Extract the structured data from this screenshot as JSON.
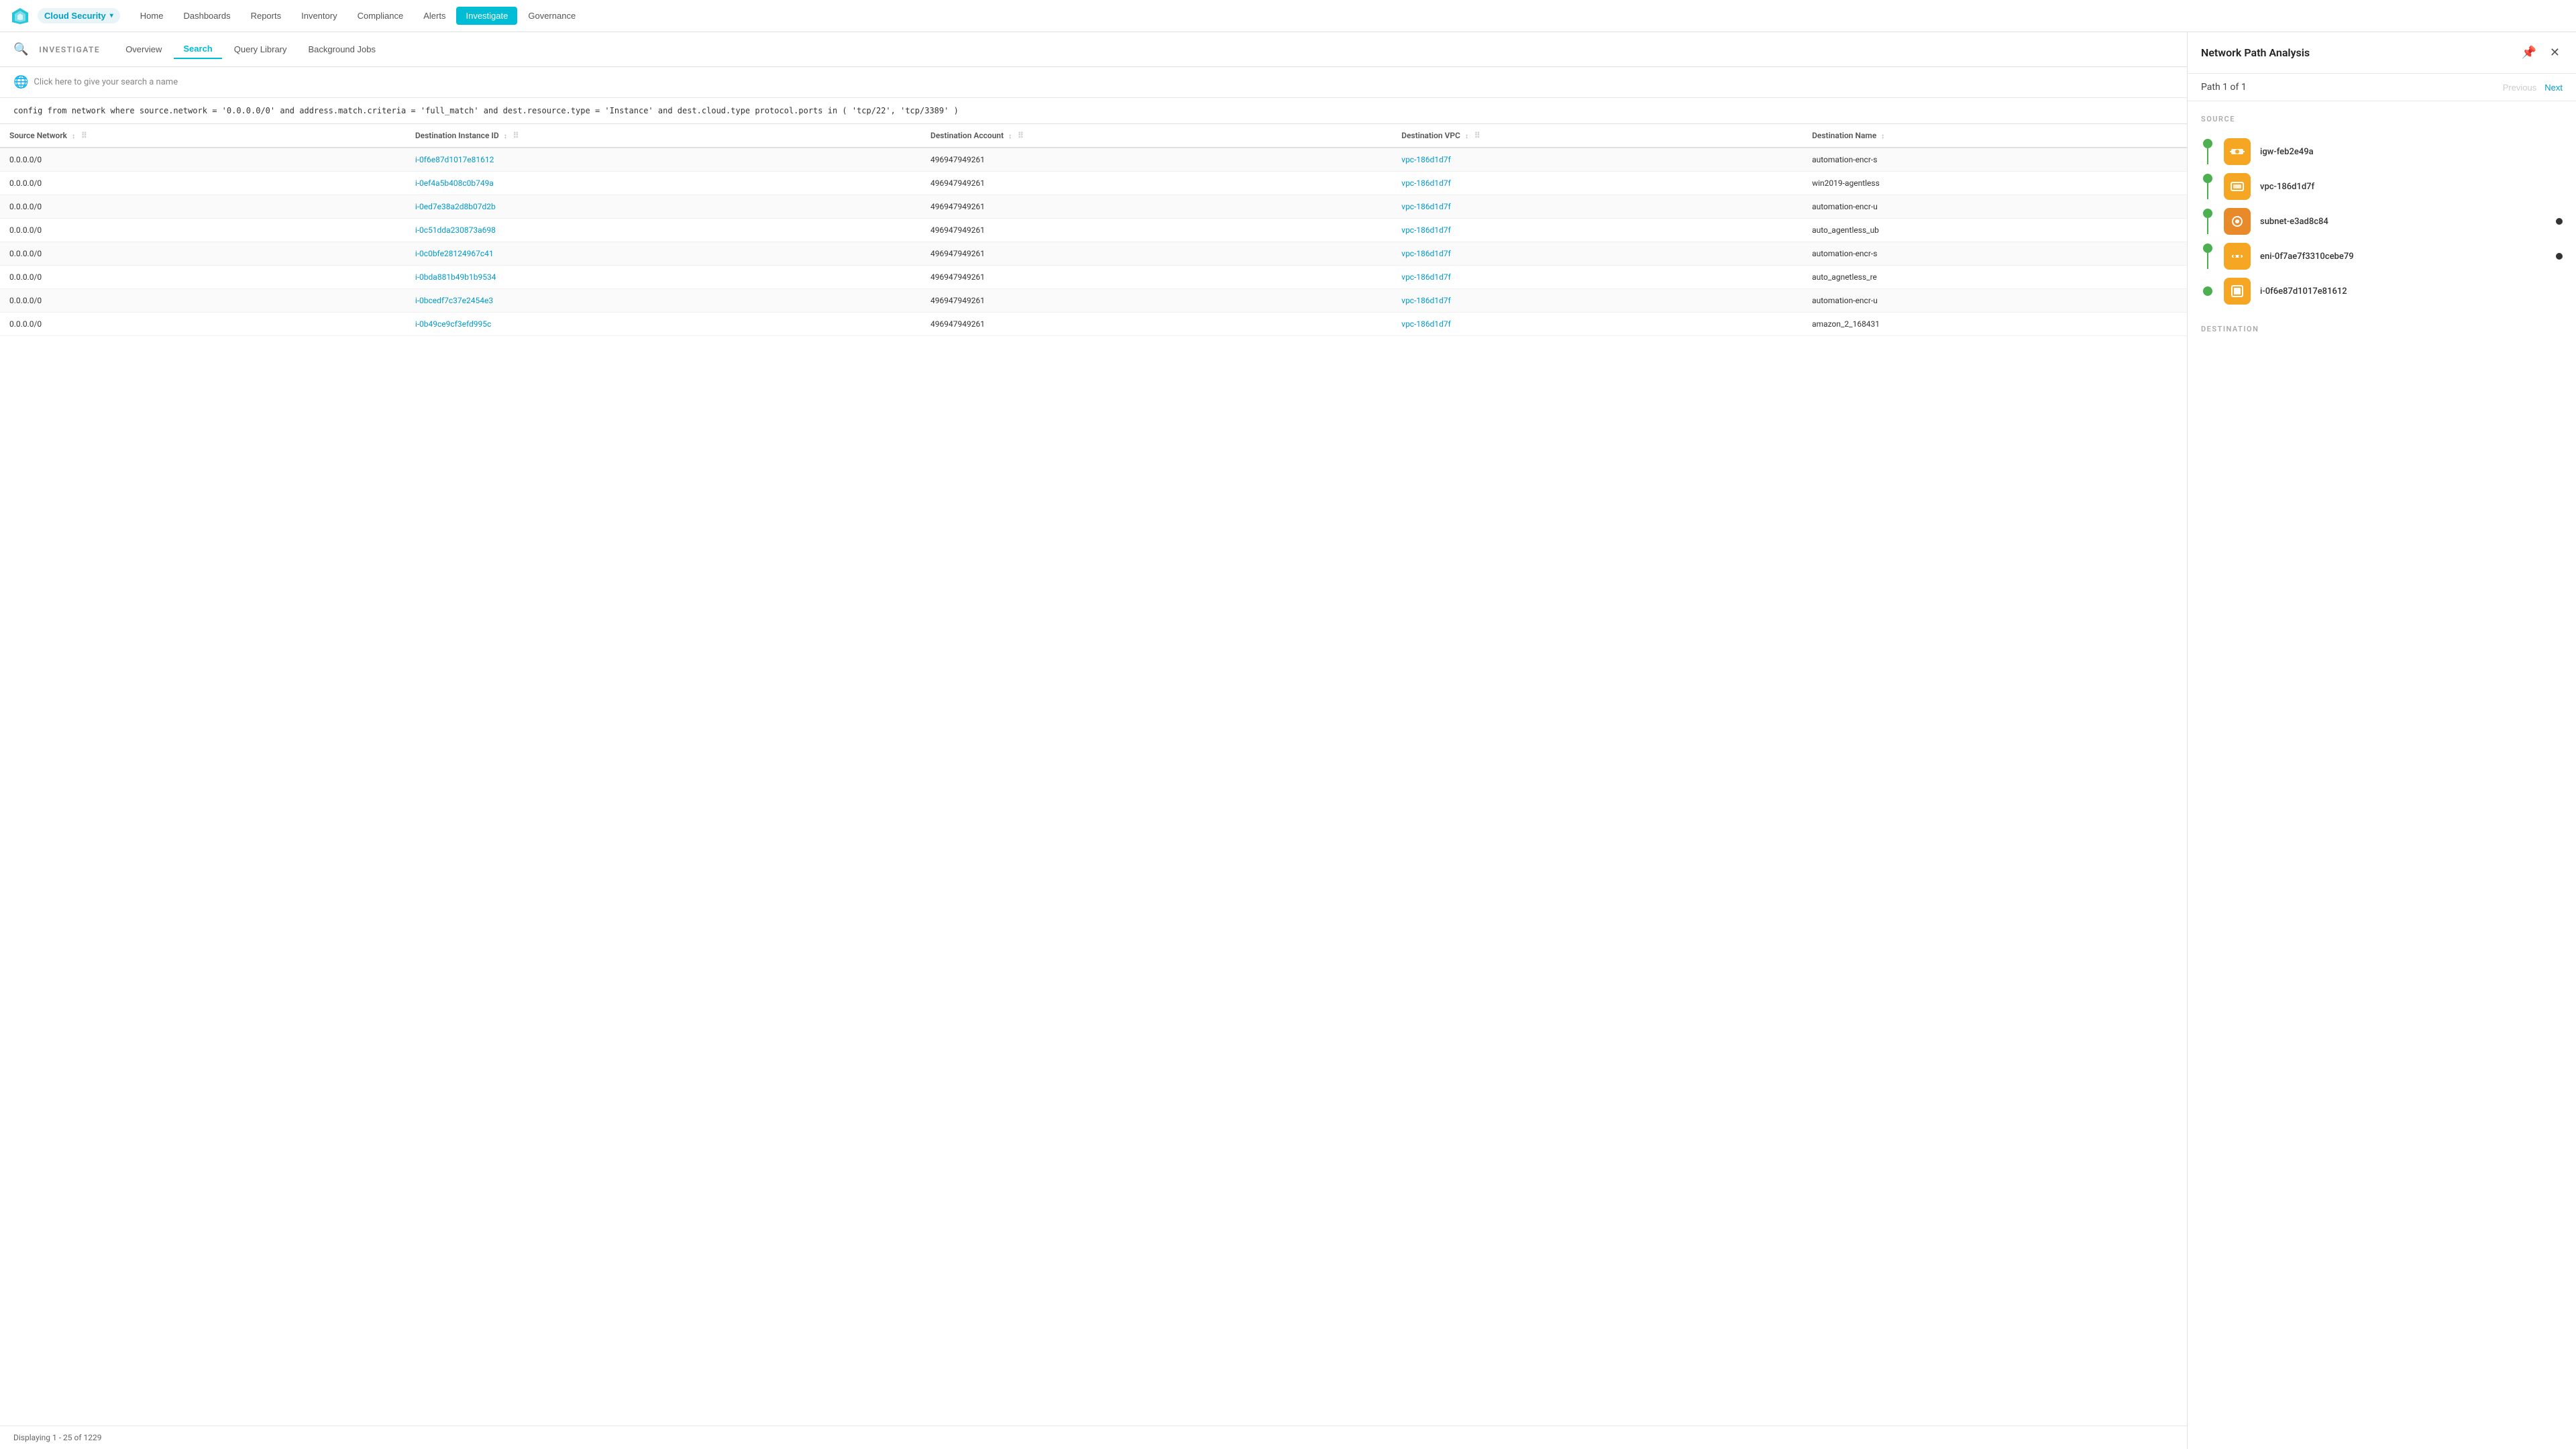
{
  "topNav": {
    "brand": "Cloud Security",
    "brandChevron": "▾",
    "links": [
      "Home",
      "Dashboards",
      "Reports",
      "Inventory",
      "Compliance",
      "Alerts",
      "Investigate",
      "Governance"
    ],
    "activeLink": "Investigate"
  },
  "investigate": {
    "title": "INVESTIGATE",
    "tabs": [
      "Overview",
      "Search",
      "Query Library",
      "Background Jobs"
    ],
    "activeTab": "Search"
  },
  "searchName": {
    "placeholder": "Click here to give your search a name"
  },
  "query": "config from network where source.network = '0.0.0.0/0' and address.match.criteria = 'full_match' and dest.resource.type = 'Instance' and dest.cloud.type protocol.ports in ( 'tcp/22', 'tcp/3389' )",
  "table": {
    "columns": [
      {
        "label": "Source Network",
        "key": "sourceNetwork"
      },
      {
        "label": "Destination Instance ID",
        "key": "destInstanceId"
      },
      {
        "label": "Destination Account",
        "key": "destAccount"
      },
      {
        "label": "Destination VPC",
        "key": "destVpc"
      },
      {
        "label": "Destination Name",
        "key": "destName"
      }
    ],
    "rows": [
      {
        "sourceNetwork": "0.0.0.0/0",
        "destInstanceId": "i-0f6e87d1017e81612",
        "destAccount": "496947949261",
        "destVpc": "vpc-186d1d7f",
        "destName": "automation-encr-s"
      },
      {
        "sourceNetwork": "0.0.0.0/0",
        "destInstanceId": "i-0ef4a5b408c0b749a",
        "destAccount": "496947949261",
        "destVpc": "vpc-186d1d7f",
        "destName": "win2019-agentless"
      },
      {
        "sourceNetwork": "0.0.0.0/0",
        "destInstanceId": "i-0ed7e38a2d8b07d2b",
        "destAccount": "496947949261",
        "destVpc": "vpc-186d1d7f",
        "destName": "automation-encr-u"
      },
      {
        "sourceNetwork": "0.0.0.0/0",
        "destInstanceId": "i-0c51dda230873a698",
        "destAccount": "496947949261",
        "destVpc": "vpc-186d1d7f",
        "destName": "auto_agentless_ub"
      },
      {
        "sourceNetwork": "0.0.0.0/0",
        "destInstanceId": "i-0c0bfe28124967c41",
        "destAccount": "496947949261",
        "destVpc": "vpc-186d1d7f",
        "destName": "automation-encr-s"
      },
      {
        "sourceNetwork": "0.0.0.0/0",
        "destInstanceId": "i-0bda881b49b1b9534",
        "destAccount": "496947949261",
        "destVpc": "vpc-186d1d7f",
        "destName": "auto_agnetless_re"
      },
      {
        "sourceNetwork": "0.0.0.0/0",
        "destInstanceId": "i-0bcedf7c37e2454e3",
        "destAccount": "496947949261",
        "destVpc": "vpc-186d1d7f",
        "destName": "automation-encr-u"
      },
      {
        "sourceNetwork": "0.0.0.0/0",
        "destInstanceId": "i-0b49ce9cf3efd995c",
        "destAccount": "496947949261",
        "destVpc": "vpc-186d1d7f",
        "destName": "amazon_2_168431"
      }
    ],
    "footer": "Displaying 1 - 25 of 1229"
  },
  "rightPanel": {
    "title": "Network Path Analysis",
    "pathLabel": "Path",
    "pathCurrent": "1",
    "pathOf": "of",
    "pathTotal": "1",
    "prevBtn": "Previous",
    "nextBtn": "Next",
    "sourceLabel": "SOURCE",
    "destinationLabel": "DESTINATION",
    "nodes": [
      {
        "id": "igw-feb2e49a",
        "iconType": "gateway",
        "hasExtraDot": false,
        "hasLine": true
      },
      {
        "id": "vpc-186d1d7f",
        "iconType": "vpc",
        "hasExtraDot": false,
        "hasLine": true
      },
      {
        "id": "subnet-e3ad8c84",
        "iconType": "subnet",
        "hasExtraDot": true,
        "hasLine": true
      },
      {
        "id": "eni-0f7ae7f3310cebe79",
        "iconType": "eni",
        "hasExtraDot": true,
        "hasLine": true
      },
      {
        "id": "i-0f6e87d1017e81612",
        "iconType": "instance",
        "hasExtraDot": false,
        "hasLine": false
      }
    ]
  },
  "icons": {
    "pinIcon": "📌",
    "closeIcon": "✕",
    "searchIcon": "🔍",
    "globeIcon": "🌐",
    "sortIcon": "↕",
    "dragIcon": "⠿"
  }
}
